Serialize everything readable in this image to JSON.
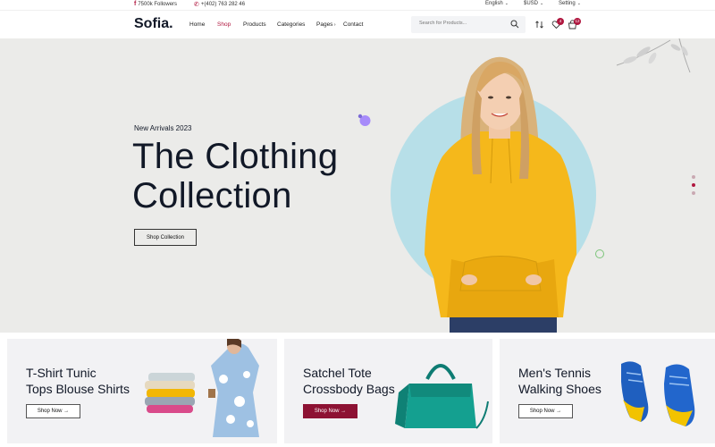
{
  "topbar": {
    "followers": "7500k Followers",
    "phone": "+(402) 763 282 46",
    "language": "English",
    "currency": "$USD",
    "setting": "Setting"
  },
  "header": {
    "logo": "Sofia.",
    "nav": [
      "Home",
      "Shop",
      "Products",
      "Categories",
      "Pages",
      "Contact"
    ],
    "active_nav": "Shop",
    "search_placeholder": "Search for Products...",
    "wishlist_count": "4",
    "cart_count": "12"
  },
  "hero": {
    "eyebrow": "New Arrivals 2023",
    "title_line1": "The Clothing",
    "title_line2": "Collection",
    "button": "Shop Collection",
    "slide_count": 3,
    "active_slide": 1
  },
  "cards": [
    {
      "title": "T-Shirt Tunic\nTops Blouse Shirts",
      "button": "Shop Now"
    },
    {
      "title": "Satchel Tote\nCrossbody Bags",
      "button": "Shop Now"
    },
    {
      "title": "Men's Tennis\nWalking Shoes",
      "button": "Shop Now"
    }
  ],
  "colors": {
    "accent": "#b0173f",
    "hero_bg": "#ebebe9",
    "hero_circle": "#b7dfe8",
    "card_bg": "#f2f2f4"
  }
}
